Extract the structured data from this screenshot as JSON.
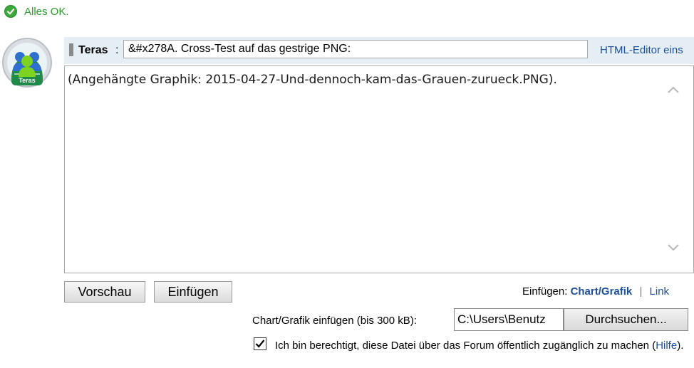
{
  "status": {
    "icon": "check-circle-icon",
    "text": "Alles OK.",
    "color": "#2e9a2e"
  },
  "author": {
    "avatar_icon": "user-group-avatar",
    "avatar_text": "Teras",
    "name": "Teras",
    "separator": ":"
  },
  "subject": {
    "value": "&#x278A. Cross-Test auf das gestrige PNG:"
  },
  "html_editor_link": "HTML-Editor eins",
  "body": {
    "text": "(Angehängte Graphik: 2015-04-27-Und-dennoch-kam-das-Grauen-zurueck.PNG)."
  },
  "buttons": {
    "preview": "Vorschau",
    "insert": "Einfügen"
  },
  "insert_links": {
    "label": "Einfügen:",
    "chart": "Chart/Grafik",
    "separator": "|",
    "link": "Link"
  },
  "upload": {
    "label": "Chart/Grafik einfügen (bis 300 kB):",
    "file_value": "C:\\Users\\Benutz",
    "browse_label": "Durchsuchen..."
  },
  "permission": {
    "checked": true,
    "text_before": "Ich bin berechtigt, diese Datei über das Forum öffentlich zugänglich zu machen (",
    "help_link": "Hilfe",
    "text_after": ")."
  },
  "colors": {
    "header_bar": "#e5edf5",
    "link": "#1b4f9c"
  }
}
